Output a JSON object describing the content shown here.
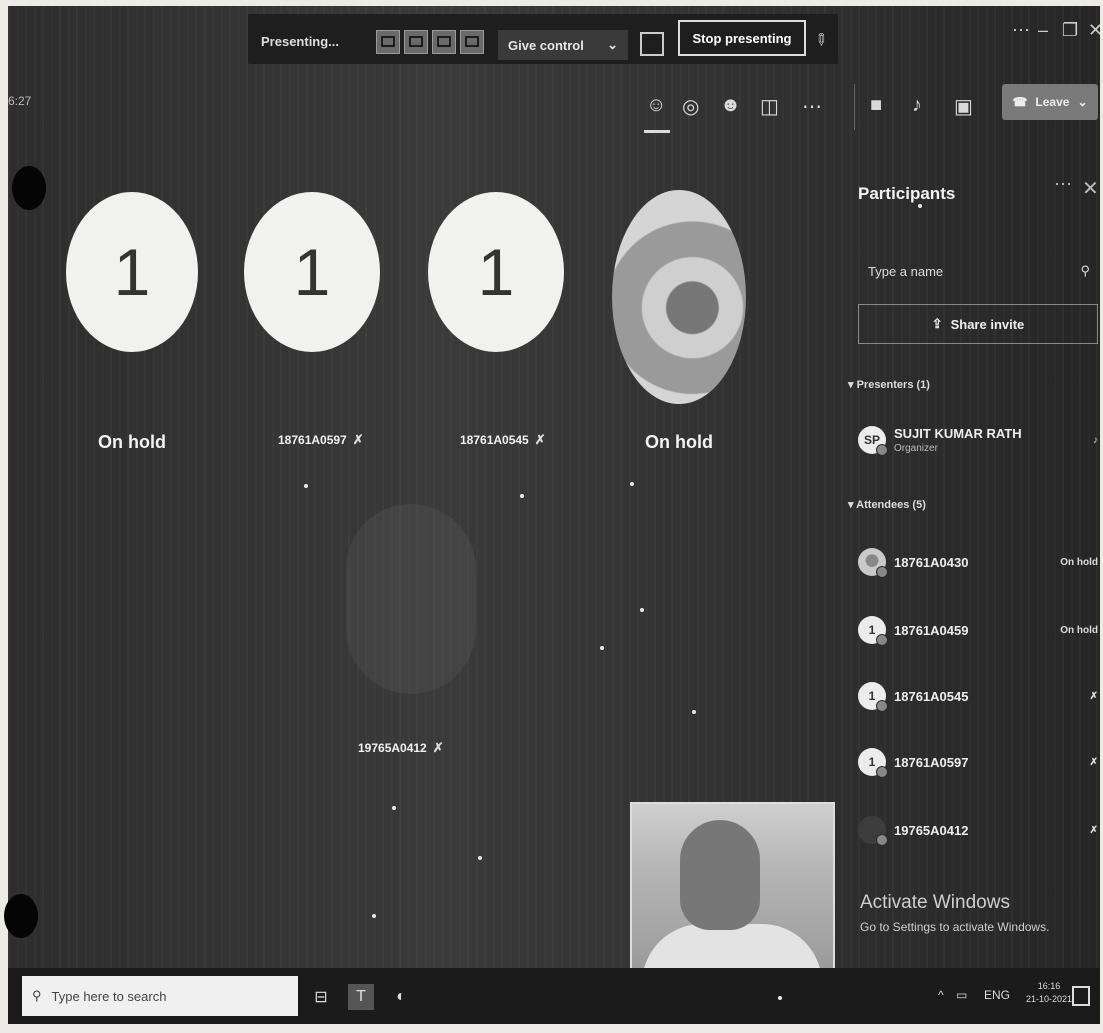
{
  "meeting": {
    "time_left": "6:27",
    "presenting_label": "Presenting...",
    "give_control_label": "Give control",
    "stop_presenting_label": "Stop presenting",
    "leave_label": "Leave"
  },
  "tiles": [
    {
      "avatar": "1",
      "label": "On hold"
    },
    {
      "avatar": "1",
      "label": "18761A0597"
    },
    {
      "avatar": "1",
      "label": "18761A0545"
    },
    {
      "avatar": "",
      "label": "On hold"
    },
    {
      "avatar": "",
      "label": "19765A0412"
    }
  ],
  "panel": {
    "title": "Participants",
    "search_placeholder": "Type a name",
    "share_invite_label": "Share invite",
    "presenters_header": "Presenters (1)",
    "attendees_header": "Attendees (5)",
    "presenters": [
      {
        "initials": "SP",
        "name": "SUJIT KUMAR RATH",
        "role": "Organizer"
      }
    ],
    "attendees": [
      {
        "initials": "",
        "name": "18761A0430",
        "status": "On hold"
      },
      {
        "initials": "1",
        "name": "18761A0459",
        "status": "On hold"
      },
      {
        "initials": "1",
        "name": "18761A0545",
        "status": ""
      },
      {
        "initials": "1",
        "name": "18761A0597",
        "status": ""
      },
      {
        "initials": "",
        "name": "19765A0412",
        "status": ""
      }
    ]
  },
  "watermark": {
    "title": "Activate Windows",
    "subtitle": "Go to Settings to activate Windows."
  },
  "taskbar": {
    "search_placeholder": "Type here to search",
    "language": "ENG",
    "time": "16:16",
    "date": "21-10-2021"
  },
  "icons": {
    "mic_off": "mic-off-icon",
    "participants": "people-icon",
    "chat": "chat-icon",
    "reactions": "reactions-icon",
    "rooms": "rooms-icon",
    "more": "more-icon",
    "camera": "camera-icon",
    "mic": "mic-icon",
    "share": "share-tray-icon",
    "leave_phone": "phone-icon"
  }
}
